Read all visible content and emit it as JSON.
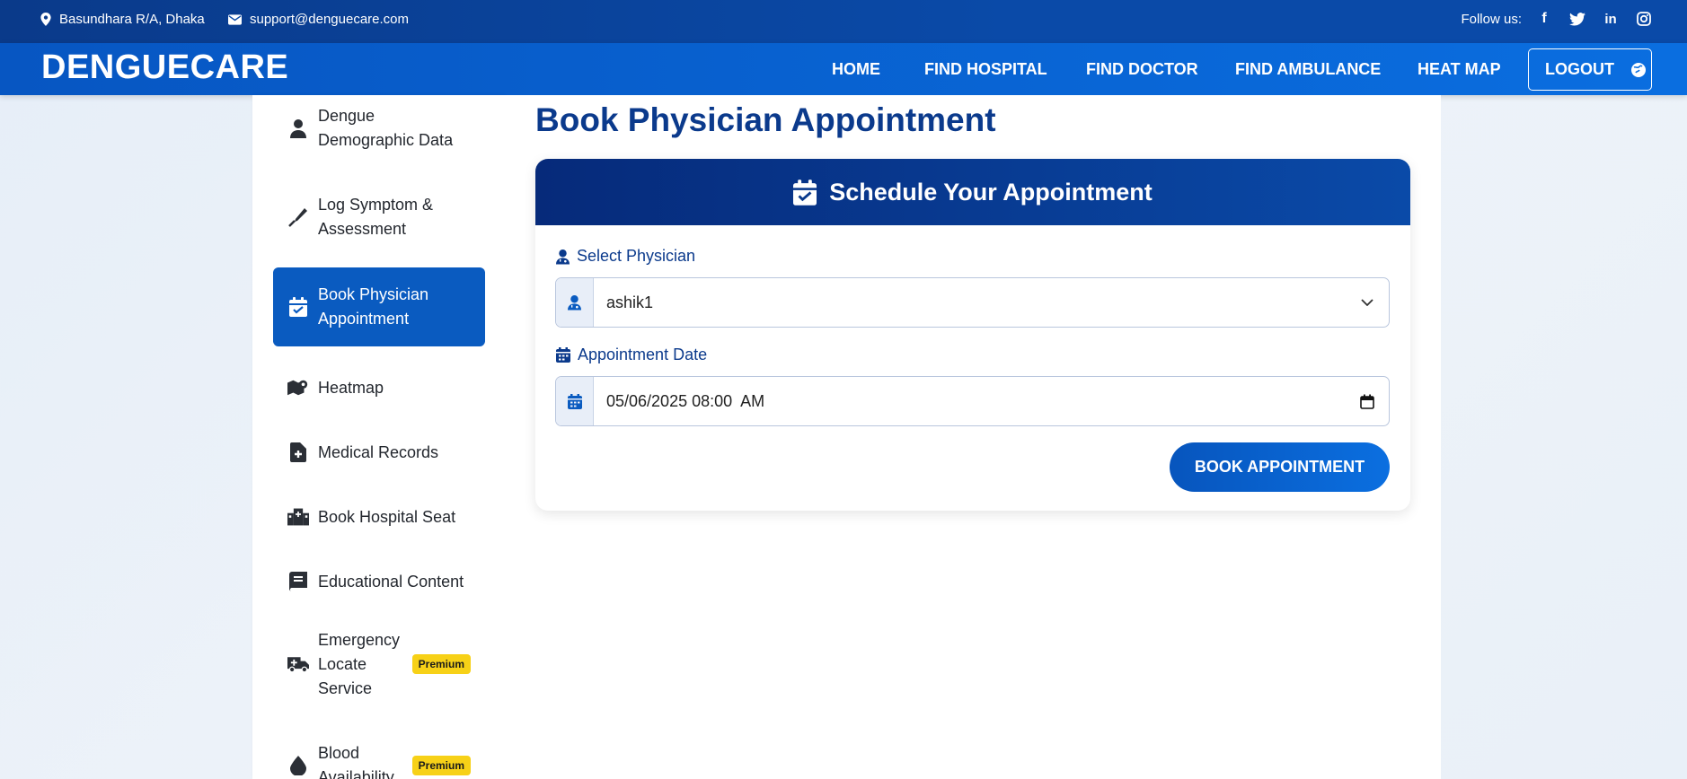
{
  "topbar": {
    "location": "Basundhara R/A, Dhaka",
    "email": "support@denguecare.com",
    "follow_label": "Follow us:",
    "socials": [
      "facebook-icon",
      "twitter-icon",
      "linkedin-icon",
      "instagram-icon"
    ]
  },
  "navbar": {
    "brand": "DENGUECARE",
    "links": [
      "HOME",
      "FIND HOSPITAL",
      "FIND DOCTOR",
      "FIND AMBULANCE",
      "HEAT MAP"
    ],
    "logout": "LOGOUT"
  },
  "sidebar": {
    "items": [
      {
        "label_line1": "Dengue",
        "label_line2": "Demographic Data",
        "icon": "user-icon"
      },
      {
        "label_line1": "Log Symptom &",
        "label_line2": "Assessment",
        "icon": "thermometer-icon"
      },
      {
        "label_line1": "Book Physician",
        "label_line2": "Appointment",
        "icon": "calendar-check-icon",
        "active": true
      },
      {
        "label": "Heatmap",
        "icon": "map-icon"
      },
      {
        "label": "Medical Records",
        "icon": "file-medical-icon"
      },
      {
        "label": "Book Hospital Seat",
        "icon": "hospital-icon"
      },
      {
        "label": "Educational Content",
        "icon": "book-icon"
      },
      {
        "label_line1": "Emergency",
        "label_line2": "Locate",
        "label_line3": "Service",
        "icon": "ambulance-icon",
        "badge": "Premium"
      },
      {
        "label_line1": "Blood",
        "label_line2": "Availability",
        "icon": "droplet-icon",
        "badge": "Premium"
      }
    ]
  },
  "main": {
    "title": "Book Physician Appointment",
    "card_title": "Schedule Your Appointment",
    "physician_label": "Select Physician",
    "physician_value": "ashik1",
    "date_label": "Appointment Date",
    "date_value": "05/06/2025 08:00  AM",
    "submit": "BOOK APPOINTMENT"
  },
  "colors": {
    "primary": "#0a5bc0",
    "dark_navy": "#0b3a8c",
    "premium_badge": "#f7d117"
  }
}
